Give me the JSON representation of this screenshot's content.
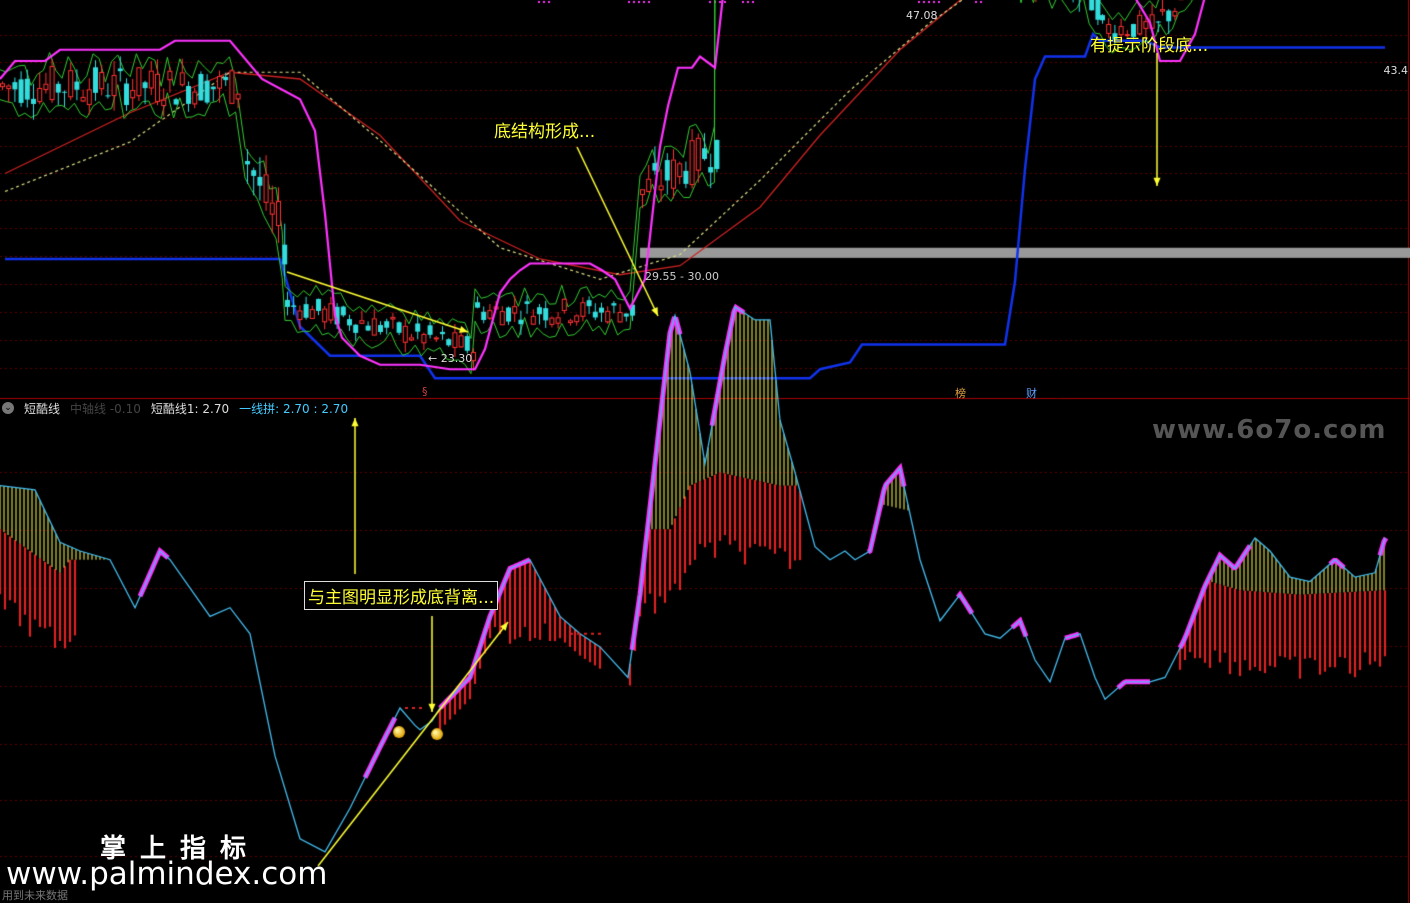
{
  "indicator": {
    "name": "短酷线",
    "series_label_1": "中轴线 -0.10",
    "series_label_2": "短酷线1: 2.70",
    "series_label_3": "一线拼: 2.70 : 2.70"
  },
  "price_panel": {
    "highlight_range_label": "29.55 - 30.00",
    "peak_label": "47.08",
    "low_label": "← 23.30",
    "right_price_label": "43.4"
  },
  "events": {
    "left": "§",
    "mid": "榜",
    "right": "财"
  },
  "annotations": {
    "bottom_structure": "底结构形成...",
    "stage_bottom_hint": "有提示阶段底...",
    "divergence": "与主图明显形成底背离..."
  },
  "watermarks": {
    "top_right": "www.6o7o.com",
    "brand_cn": "掌上指标",
    "brand_url": "www.palmindex.com"
  },
  "footer": "用到未来数据",
  "colors": {
    "up": "#ff3333",
    "down": "#33dddd",
    "upper_band": "#ff33ff",
    "inner_band": "#33cc33",
    "ma_long": "#cc2222",
    "ma_dashed": "#dddd88",
    "support": "#1133ee",
    "highlight": "#999999",
    "osc_line": "#44bbee",
    "osc_magenta": "#ff33ff",
    "osc_yellow": "#ffff55",
    "osc_red": "#dd2222"
  },
  "chart_data": [
    {
      "type": "candlestick",
      "panel": "price",
      "y_range_note": "approx 21 - 49",
      "upper_band": [
        [
          0,
          37.5
        ],
        [
          15,
          38.3
        ],
        [
          45,
          38.3
        ],
        [
          60,
          38.8
        ],
        [
          95,
          38.8
        ],
        [
          130,
          38.8
        ],
        [
          160,
          38.8
        ],
        [
          175,
          39.2
        ],
        [
          230,
          39.2
        ],
        [
          262,
          37.5
        ],
        [
          300,
          36.6
        ],
        [
          315,
          35.2
        ],
        [
          325,
          31.5
        ],
        [
          335,
          27.0
        ],
        [
          342,
          26.0
        ],
        [
          360,
          25.2
        ],
        [
          380,
          24.8
        ],
        [
          420,
          24.8
        ],
        [
          450,
          24.6
        ],
        [
          475,
          24.6
        ],
        [
          485,
          25.5
        ],
        [
          500,
          28.0
        ],
        [
          510,
          28.6
        ],
        [
          520,
          29.0
        ],
        [
          530,
          29.3
        ],
        [
          560,
          29.3
        ],
        [
          590,
          29.3
        ],
        [
          602,
          29.0
        ],
        [
          615,
          28.6
        ],
        [
          630,
          27.3
        ],
        [
          645,
          28.6
        ],
        [
          650,
          30.5
        ],
        [
          660,
          34.5
        ],
        [
          668,
          36.3
        ],
        [
          678,
          38.0
        ],
        [
          692,
          38.0
        ],
        [
          700,
          38.5
        ],
        [
          715,
          38.0
        ],
        [
          725,
          42.0
        ],
        [
          740,
          46.0
        ],
        [
          752,
          47.0
        ],
        [
          768,
          47.8
        ],
        [
          833,
          47.8
        ],
        [
          842,
          46.5
        ],
        [
          855,
          44.3
        ],
        [
          860,
          43.5
        ],
        [
          870,
          43.5
        ],
        [
          878,
          45.6
        ],
        [
          885,
          47.5
        ],
        [
          893,
          48.3
        ],
        [
          900,
          49.8
        ],
        [
          918,
          49.8
        ],
        [
          940,
          49.8
        ],
        [
          975,
          49.8
        ],
        [
          985,
          47.0
        ],
        [
          993,
          45.0
        ],
        [
          1030,
          45.0
        ],
        [
          1045,
          44.0
        ],
        [
          1060,
          43.8
        ],
        [
          1075,
          43.0
        ],
        [
          1085,
          43.0
        ],
        [
          1100,
          41.8
        ],
        [
          1130,
          41.5
        ],
        [
          1150,
          40.0
        ],
        [
          1160,
          38.3
        ],
        [
          1180,
          38.3
        ],
        [
          1195,
          39.5
        ],
        [
          1210,
          42.0
        ],
        [
          1245,
          43.5
        ],
        [
          1260,
          45.0
        ],
        [
          1340,
          45.0
        ],
        [
          1360,
          45.5
        ],
        [
          1385,
          45.5
        ]
      ],
      "support_line": [
        [
          5,
          29.5
        ],
        [
          280,
          29.5
        ],
        [
          300,
          26.5
        ],
        [
          330,
          25.2
        ],
        [
          420,
          25.2
        ],
        [
          435,
          24.2
        ],
        [
          810,
          24.2
        ],
        [
          820,
          24.6
        ],
        [
          850,
          24.9
        ],
        [
          862,
          25.7
        ],
        [
          1005,
          25.7
        ],
        [
          1015,
          28.5
        ],
        [
          1025,
          33.5
        ],
        [
          1035,
          37.5
        ],
        [
          1045,
          38.5
        ],
        [
          1085,
          38.5
        ],
        [
          1093,
          39.5
        ],
        [
          1100,
          39.2
        ],
        [
          1145,
          39.2
        ],
        [
          1160,
          38.9
        ],
        [
          1385,
          38.9
        ]
      ],
      "ma_long": [
        [
          5,
          33.3
        ],
        [
          130,
          36.0
        ],
        [
          230,
          37.8
        ],
        [
          300,
          37.5
        ],
        [
          380,
          35.0
        ],
        [
          460,
          31.2
        ],
        [
          540,
          29.5
        ],
        [
          620,
          28.8
        ],
        [
          680,
          29.2
        ],
        [
          760,
          31.8
        ],
        [
          820,
          35.0
        ],
        [
          900,
          38.8
        ],
        [
          960,
          41.0
        ],
        [
          1010,
          42.3
        ],
        [
          1050,
          42.6
        ],
        [
          1100,
          42.6
        ],
        [
          1150,
          42.0
        ],
        [
          1200,
          41.4
        ],
        [
          1250,
          41.2
        ],
        [
          1300,
          41.7
        ],
        [
          1385,
          42.6
        ]
      ],
      "ma_dashed": [
        [
          5,
          32.5
        ],
        [
          130,
          34.7
        ],
        [
          230,
          37.8
        ],
        [
          300,
          37.8
        ],
        [
          400,
          34.0
        ],
        [
          500,
          30.0
        ],
        [
          600,
          28.6
        ],
        [
          680,
          29.7
        ],
        [
          760,
          33.0
        ],
        [
          850,
          37.0
        ],
        [
          930,
          40.0
        ],
        [
          1000,
          42.2
        ],
        [
          1050,
          42.8
        ],
        [
          1100,
          42.5
        ],
        [
          1160,
          41.8
        ],
        [
          1210,
          41.5
        ],
        [
          1280,
          42.0
        ],
        [
          1385,
          42.6
        ]
      ],
      "highlight_band": [
        640,
        1410,
        29.55,
        30.0
      ],
      "regimes": [
        {
          "from": 0,
          "to": 240,
          "level": 37.2,
          "amp": 0.9
        },
        {
          "from": 245,
          "to": 285,
          "level": 32.0,
          "amp": 1.2,
          "slope": -4.0
        },
        {
          "from": 285,
          "to": 475,
          "level": 26.5,
          "amp": 0.6,
          "slope": -2.0
        },
        {
          "from": 475,
          "to": 635,
          "level": 27.2,
          "amp": 0.6
        },
        {
          "from": 640,
          "to": 715,
          "level": 33.5,
          "amp": 1.0,
          "slope": 2.0
        },
        {
          "from": 715,
          "to": 870,
          "level": 43.0,
          "amp": 1.3
        },
        {
          "from": 870,
          "to": 990,
          "level": 44.6,
          "amp": 1.6
        },
        {
          "from": 990,
          "to": 1100,
          "level": 42.0,
          "amp": 1.0,
          "slope": -2.0
        },
        {
          "from": 1100,
          "to": 1160,
          "level": 39.8,
          "amp": 0.6
        },
        {
          "from": 1160,
          "to": 1220,
          "level": 41.5,
          "amp": 0.8,
          "slope": 2.5
        },
        {
          "from": 1220,
          "to": 1385,
          "level": 44.0,
          "amp": 0.9
        }
      ]
    },
    {
      "type": "area",
      "panel": "oscillator",
      "y_range_note": "approx -2 to 10",
      "main_line": [
        [
          0,
          5.0
        ],
        [
          35,
          4.9
        ],
        [
          60,
          3.7
        ],
        [
          80,
          3.5
        ],
        [
          110,
          3.3
        ],
        [
          135,
          2.2
        ],
        [
          160,
          3.5
        ],
        [
          170,
          3.3
        ],
        [
          210,
          2.0
        ],
        [
          230,
          2.2
        ],
        [
          250,
          1.6
        ],
        [
          275,
          -1.2
        ],
        [
          300,
          -3.1
        ],
        [
          325,
          -3.4
        ],
        [
          350,
          -2.4
        ],
        [
          380,
          -1.0
        ],
        [
          400,
          -0.1
        ],
        [
          415,
          -0.5
        ],
        [
          420,
          -0.6
        ],
        [
          432,
          -0.4
        ],
        [
          440,
          -0.1
        ],
        [
          470,
          0.6
        ],
        [
          490,
          2.0
        ],
        [
          510,
          3.1
        ],
        [
          530,
          3.3
        ],
        [
          560,
          2.0
        ],
        [
          580,
          1.6
        ],
        [
          600,
          1.3
        ],
        [
          628,
          0.6
        ],
        [
          640,
          2.5
        ],
        [
          655,
          5.5
        ],
        [
          670,
          8.5
        ],
        [
          675,
          8.9
        ],
        [
          690,
          7.6
        ],
        [
          705,
          5.5
        ],
        [
          725,
          8.0
        ],
        [
          735,
          9.1
        ],
        [
          755,
          8.8
        ],
        [
          770,
          8.8
        ],
        [
          780,
          6.5
        ],
        [
          795,
          5.3
        ],
        [
          815,
          3.6
        ],
        [
          830,
          3.3
        ],
        [
          845,
          3.5
        ],
        [
          855,
          3.3
        ],
        [
          870,
          3.5
        ],
        [
          885,
          5.0
        ],
        [
          900,
          5.4
        ],
        [
          920,
          3.3
        ],
        [
          940,
          1.9
        ],
        [
          960,
          2.5
        ],
        [
          985,
          1.6
        ],
        [
          1000,
          1.5
        ],
        [
          1020,
          1.9
        ],
        [
          1035,
          1.0
        ],
        [
          1050,
          0.5
        ],
        [
          1065,
          1.5
        ],
        [
          1080,
          1.6
        ],
        [
          1095,
          0.6
        ],
        [
          1105,
          0.1
        ],
        [
          1125,
          0.5
        ],
        [
          1150,
          0.5
        ],
        [
          1165,
          0.6
        ],
        [
          1185,
          1.5
        ],
        [
          1205,
          2.7
        ],
        [
          1220,
          3.4
        ],
        [
          1235,
          3.1
        ],
        [
          1255,
          3.8
        ],
        [
          1270,
          3.5
        ],
        [
          1290,
          2.9
        ],
        [
          1310,
          2.8
        ],
        [
          1335,
          3.3
        ],
        [
          1355,
          2.9
        ],
        [
          1375,
          3.0
        ],
        [
          1385,
          3.8
        ]
      ],
      "red_level": [
        [
          0,
          4.0
        ],
        [
          60,
          3.0
        ],
        [
          70,
          3.3
        ],
        [
          630,
          3.3
        ],
        [
          640,
          4.0
        ],
        [
          670,
          4.0
        ],
        [
          690,
          5.0
        ],
        [
          720,
          5.3
        ],
        [
          780,
          5.0
        ],
        [
          800,
          5.0
        ],
        [
          1180,
          3.0
        ],
        [
          1240,
          2.6
        ],
        [
          1300,
          2.5
        ],
        [
          1385,
          2.6
        ]
      ],
      "red_ranges": [
        [
          0,
          75
        ],
        [
          440,
          600
        ],
        [
          630,
          800
        ],
        [
          1180,
          1385
        ]
      ],
      "markers": [
        [
          399,
          -0.65
        ],
        [
          437,
          -0.7
        ]
      ],
      "dashes": [
        [
          405,
          -0.1,
          425
        ],
        [
          570,
          1.6,
          605
        ]
      ]
    }
  ]
}
